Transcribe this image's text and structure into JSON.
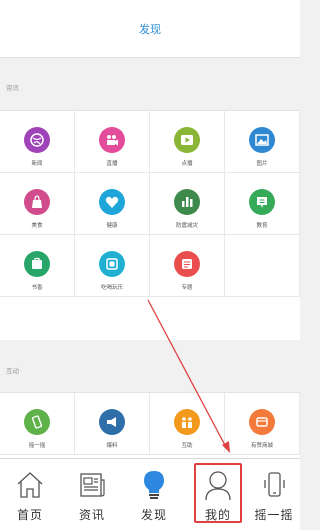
{
  "header": {
    "title": "发现"
  },
  "sections": {
    "news": {
      "label": "资讯",
      "items": [
        {
          "label": "新闻",
          "icon": "globe-icon",
          "color": "#a043b8"
        },
        {
          "label": "直播",
          "icon": "video-camera-icon",
          "color": "#e24c9a"
        },
        {
          "label": "点播",
          "icon": "play-icon",
          "color": "#8bb536"
        },
        {
          "label": "图片",
          "icon": "picture-icon",
          "color": "#2f88d2"
        },
        {
          "label": "美食",
          "icon": "food-bag-icon",
          "color": "#d04c8c"
        },
        {
          "label": "健康",
          "icon": "heart-icon",
          "color": "#1ea6d8"
        },
        {
          "label": "防震减灾",
          "icon": "bar-chart-icon",
          "color": "#3e8a4c"
        },
        {
          "label": "教育",
          "icon": "education-icon",
          "color": "#35ab5a"
        },
        {
          "label": "书香",
          "icon": "book-icon",
          "color": "#28a66a"
        },
        {
          "label": "吃喝玩乐",
          "icon": "leisure-icon",
          "color": "#1fb0cf"
        },
        {
          "label": "专题",
          "icon": "topic-icon",
          "color": "#ea4d4d"
        }
      ]
    },
    "interact": {
      "label": "互动",
      "items": [
        {
          "label": "摇一摇",
          "icon": "shake-phone-icon",
          "color": "#5fb14a"
        },
        {
          "label": "爆料",
          "icon": "megaphone-icon",
          "color": "#2f6fa9"
        },
        {
          "label": "互助",
          "icon": "people-icon",
          "color": "#f39a1c"
        },
        {
          "label": "有赞商城",
          "icon": "shop-icon",
          "color": "#f37a3a"
        }
      ]
    }
  },
  "tabbar": {
    "items": [
      {
        "label": "首页",
        "icon": "home-icon"
      },
      {
        "label": "资讯",
        "icon": "newspaper-icon"
      },
      {
        "label": "发现",
        "icon": "lightbulb-icon"
      },
      {
        "label": "我的",
        "icon": "user-icon"
      },
      {
        "label": "摇一摇",
        "icon": "shake-icon"
      }
    ]
  },
  "colors": {
    "accent": "#2d8fd6",
    "highlight": "#e04040"
  }
}
